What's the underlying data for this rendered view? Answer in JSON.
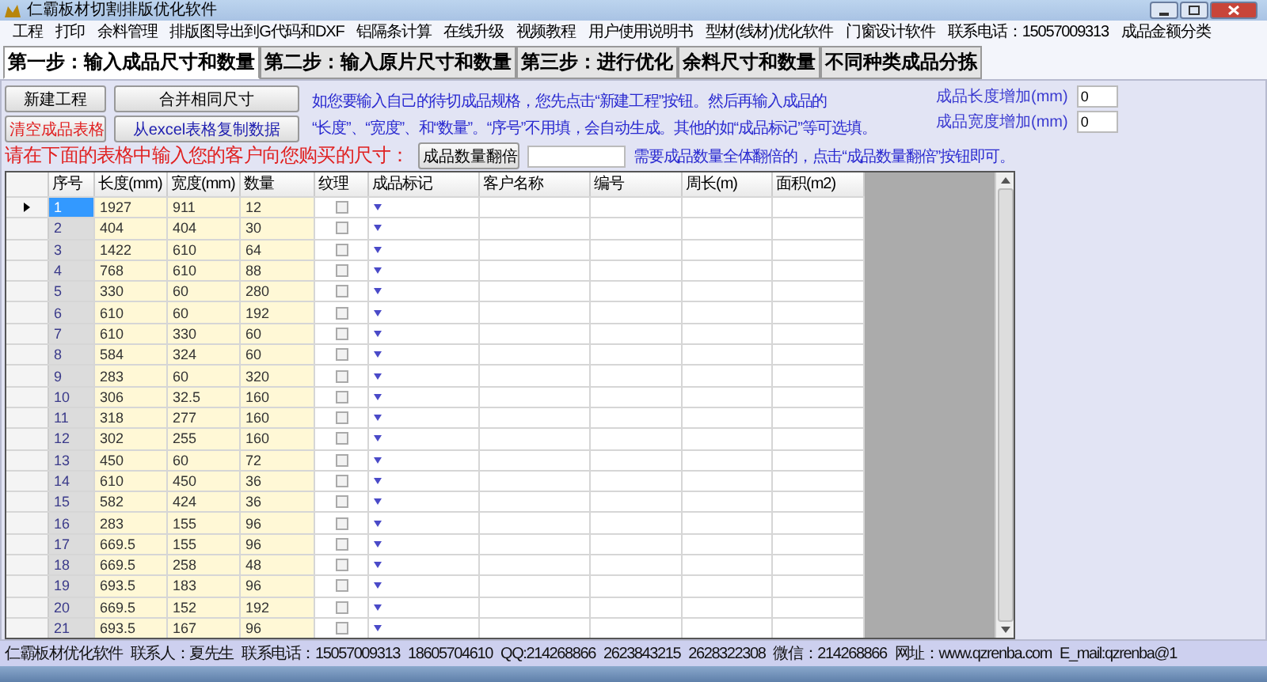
{
  "window": {
    "title": "仁霸板材切割排版优化软件"
  },
  "menu": [
    "工程",
    "打印",
    "余料管理",
    "排版图导出到G代码和DXF",
    "铝隔条计算",
    "在线升级",
    "视频教程",
    "用户使用说明书",
    "型材(线材)优化软件",
    "门窗设计软件",
    "联系电话：15057009313",
    "成品金额分类"
  ],
  "tabs": [
    {
      "label": "第一步：输入成品尺寸和数量",
      "selected": true
    },
    {
      "label": "第二步：输入原片尺寸和数量",
      "selected": false
    },
    {
      "label": "第三步：进行优化",
      "selected": false
    },
    {
      "label": "余料尺寸和数量",
      "selected": false
    },
    {
      "label": "不同种类成品分拣",
      "selected": false
    }
  ],
  "buttons": [
    {
      "label": "新建工程",
      "kind": "normal"
    },
    {
      "label": "合并相同尺寸",
      "kind": "normal"
    },
    {
      "label": "清空成品表格",
      "kind": "danger"
    },
    {
      "label": "从excel表格复制数据",
      "kind": "link"
    }
  ],
  "instructions": [
    "如您要输入自己的待切成品规格，您先点击“新建工程”按钮。然后再输入成品的",
    "“长度”、“宽度”、和“数量”。“序号”不用填，会自动生成。其他的如“成品标记”等可选填。"
  ],
  "adjust_fields": [
    {
      "label": "成品长度增加(mm)",
      "value": "0"
    },
    {
      "label": "成品宽度增加(mm)",
      "value": "0"
    }
  ],
  "prompt": "请在下面的表格中输入您的客户向您购买的尺寸：",
  "double_button": "成品数量翻倍",
  "double_hint": "需要成品数量全体翻倍的，点击“成品数量翻倍”按钮即可。",
  "table": {
    "columns": [
      "序号",
      "长度(mm)",
      "宽度(mm)",
      "数量",
      "纹理",
      "成品标记",
      "客户名称",
      "编号",
      "周长(m)",
      "面积(m2)"
    ],
    "rows": [
      {
        "cells": [
          "1",
          "1927",
          "911",
          "12"
        ],
        "checked": false,
        "selected": true
      },
      {
        "cells": [
          "2",
          "404",
          "404",
          "30"
        ],
        "checked": false,
        "selected": false
      },
      {
        "cells": [
          "3",
          "1422",
          "610",
          "64"
        ],
        "checked": false,
        "selected": false
      },
      {
        "cells": [
          "4",
          "768",
          "610",
          "88"
        ],
        "checked": false,
        "selected": false
      },
      {
        "cells": [
          "5",
          "330",
          "60",
          "280"
        ],
        "checked": false,
        "selected": false
      },
      {
        "cells": [
          "6",
          "610",
          "60",
          "192"
        ],
        "checked": false,
        "selected": false
      },
      {
        "cells": [
          "7",
          "610",
          "330",
          "60"
        ],
        "checked": false,
        "selected": false
      },
      {
        "cells": [
          "8",
          "584",
          "324",
          "60"
        ],
        "checked": false,
        "selected": false
      },
      {
        "cells": [
          "9",
          "283",
          "60",
          "320"
        ],
        "checked": false,
        "selected": false
      },
      {
        "cells": [
          "10",
          "306",
          "32.5",
          "160"
        ],
        "checked": false,
        "selected": false
      },
      {
        "cells": [
          "11",
          "318",
          "277",
          "160"
        ],
        "checked": false,
        "selected": false
      },
      {
        "cells": [
          "12",
          "302",
          "255",
          "160"
        ],
        "checked": false,
        "selected": false
      },
      {
        "cells": [
          "13",
          "450",
          "60",
          "72"
        ],
        "checked": false,
        "selected": false
      },
      {
        "cells": [
          "14",
          "610",
          "450",
          "36"
        ],
        "checked": false,
        "selected": false
      },
      {
        "cells": [
          "15",
          "582",
          "424",
          "36"
        ],
        "checked": false,
        "selected": false
      },
      {
        "cells": [
          "16",
          "283",
          "155",
          "96"
        ],
        "checked": false,
        "selected": false
      },
      {
        "cells": [
          "17",
          "669.5",
          "155",
          "96"
        ],
        "checked": false,
        "selected": false
      },
      {
        "cells": [
          "18",
          "669.5",
          "258",
          "48"
        ],
        "checked": false,
        "selected": false
      },
      {
        "cells": [
          "19",
          "693.5",
          "183",
          "96"
        ],
        "checked": false,
        "selected": false
      },
      {
        "cells": [
          "20",
          "669.5",
          "152",
          "192"
        ],
        "checked": false,
        "selected": false
      },
      {
        "cells": [
          "21",
          "693.5",
          "167",
          "96"
        ],
        "checked": false,
        "selected": false
      }
    ]
  },
  "status_bar": [
    "仁霸板材优化软件",
    "联系人：夏先生",
    "联系电话：15057009313",
    "18605704610",
    "QQ:214268866",
    "2623843215",
    "2628322308",
    "微信：214268866",
    "网址：www.qzrenba.com",
    "E_mail:qzrenba@1"
  ]
}
